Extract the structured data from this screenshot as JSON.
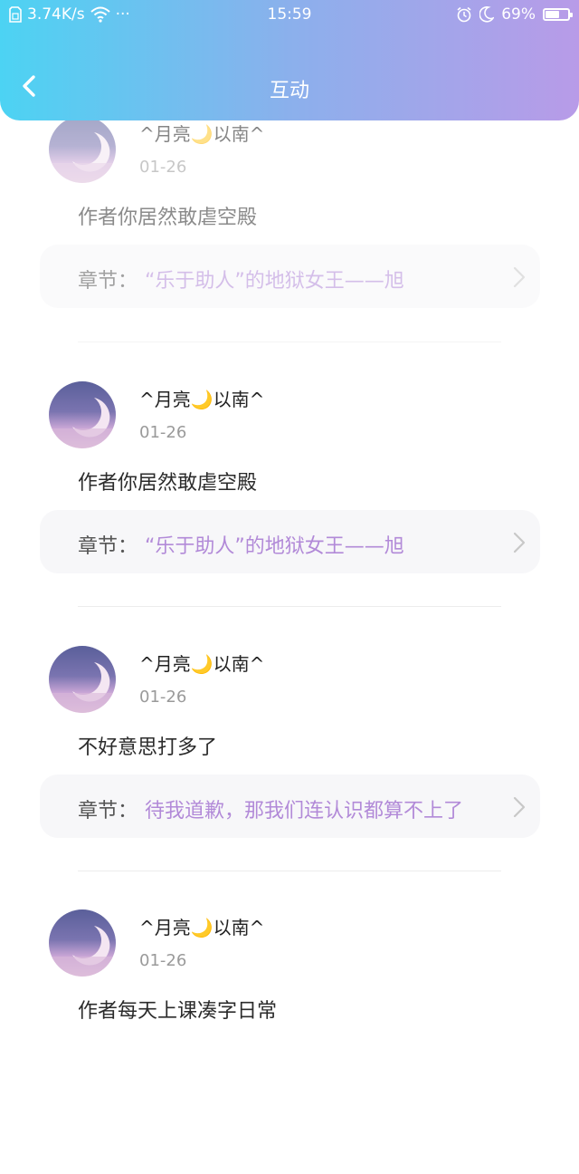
{
  "status_bar": {
    "speed": "3.74K/s",
    "dots": "···",
    "time": "15:59",
    "battery_percent": "69%",
    "battery_level": 0.69
  },
  "header": {
    "title": "互动"
  },
  "comments": [
    {
      "username": "^月亮🌙以南^",
      "date": "01-26",
      "text": "作者你居然敢虐空殿",
      "chapter_label": "章节：",
      "chapter_title": "“乐于助人”的地狱女王——旭"
    },
    {
      "username": "^月亮🌙以南^",
      "date": "01-26",
      "text": "作者你居然敢虐空殿",
      "chapter_label": "章节：",
      "chapter_title": "“乐于助人”的地狱女王——旭"
    },
    {
      "username": "^月亮🌙以南^",
      "date": "01-26",
      "text": "不好意思打多了",
      "chapter_label": "章节：",
      "chapter_title": "待我道歉，那我们连认识都算不上了"
    },
    {
      "username": "^月亮🌙以南^",
      "date": "01-26",
      "text": "作者每天上课凑字日常"
    }
  ],
  "colors": {
    "header_gradient_start": "#4cd3f3",
    "header_gradient_end": "#b89be8",
    "chapter_title": "#b28ad8"
  }
}
